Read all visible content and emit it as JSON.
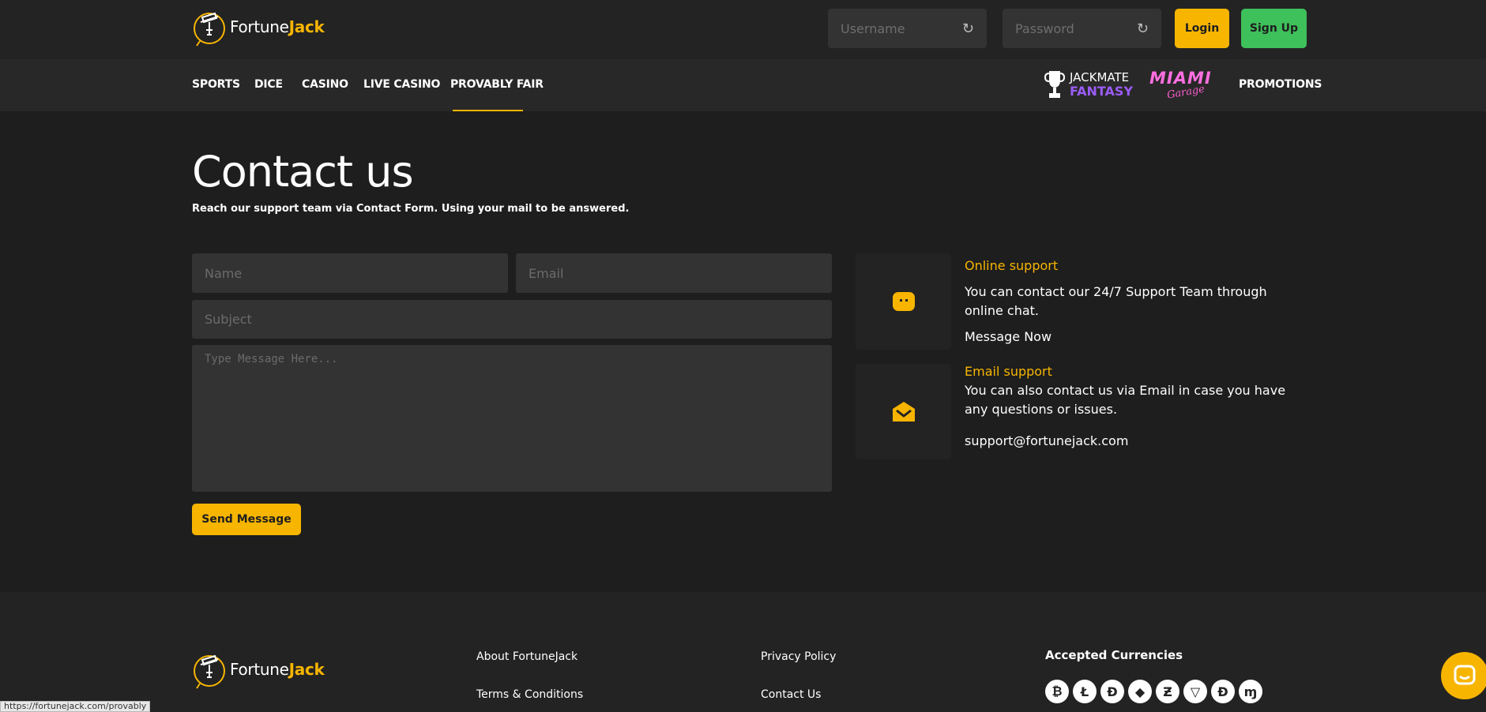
{
  "brand": {
    "name_part1": "Fortune",
    "name_part2": "Jack",
    "accent_color": "#f7b500"
  },
  "header": {
    "username_placeholder": "Username",
    "password_placeholder": "Password",
    "refresh_icon": "refresh-icon",
    "login_label": "Login",
    "signup_label": "Sign Up"
  },
  "nav": {
    "items": [
      "SPORTS",
      "DICE",
      "CASINO",
      "LIVE CASINO",
      "PROVABLY FAIR"
    ],
    "active": "PROVABLY FAIR",
    "jackmate_top": "JACKMATE",
    "jackmate_bottom": "FANTASY",
    "miami_logo": "MIAMI Garage",
    "promotions": "PROMOTIONS"
  },
  "page": {
    "title": "Contact us",
    "subtitle": "Reach our support team via Contact Form. Using your mail to be answered."
  },
  "form": {
    "name_placeholder": "Name",
    "email_placeholder": "Email",
    "subject_placeholder": "Subject",
    "message_placeholder": "Type Message Here...",
    "send_label": "Send Message"
  },
  "support": {
    "online_title": "Online support",
    "online_text": "You can contact our 24/7 Support Team through online chat.",
    "online_link": "Message Now",
    "email_title": "Email support",
    "email_text": "You can also contact us via Email in case you have any questions or issues.",
    "email_address": "support@fortunejack.com"
  },
  "footer": {
    "about": "About FortuneJack",
    "terms": "Terms & Conditions",
    "privacy": "Privacy Policy",
    "contact": "Contact Us",
    "currencies_heading": "Accepted Currencies",
    "currency_icons": [
      "bitcoin-icon",
      "litecoin-icon",
      "dogecoin-icon",
      "ethereum-icon",
      "zcash-icon",
      "tron-icon",
      "dash-icon",
      "monero-icon"
    ]
  },
  "status_bar_url": "https://fortunejack.com/provably"
}
